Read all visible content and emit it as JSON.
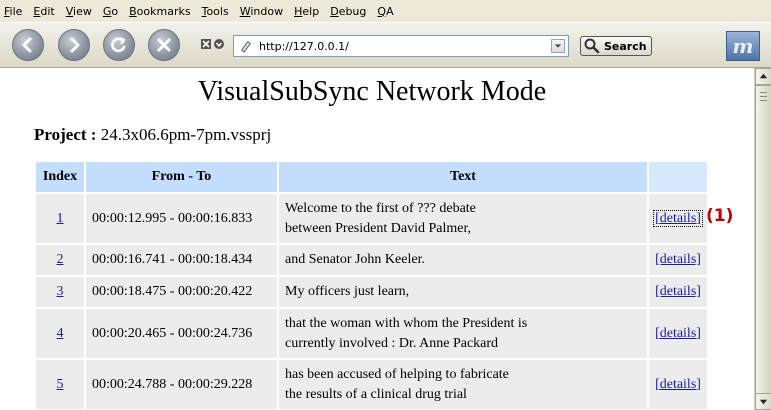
{
  "menu": [
    {
      "pre": "",
      "ul": "F",
      "post": "ile"
    },
    {
      "pre": "",
      "ul": "E",
      "post": "dit"
    },
    {
      "pre": "",
      "ul": "V",
      "post": "iew"
    },
    {
      "pre": "",
      "ul": "G",
      "post": "o"
    },
    {
      "pre": "",
      "ul": "B",
      "post": "ookmarks"
    },
    {
      "pre": "",
      "ul": "T",
      "post": "ools"
    },
    {
      "pre": "",
      "ul": "W",
      "post": "indow"
    },
    {
      "pre": "",
      "ul": "H",
      "post": "elp"
    },
    {
      "pre": "",
      "ul": "D",
      "post": "ebug"
    },
    {
      "pre": "",
      "ul": "Q",
      "post": "A"
    }
  ],
  "navbar": {
    "url": "http://127.0.0.1/",
    "search_label": "Search",
    "throbber_letter": "m"
  },
  "page": {
    "title": "VisualSubSync Network Mode",
    "project_label": "Project :",
    "project_name": "24.3x06.6pm-7pm.vssprj"
  },
  "table": {
    "headers": {
      "index": "Index",
      "time": "From - To",
      "text": "Text",
      "details": ""
    },
    "rows": [
      {
        "index": "1",
        "time": "00:00:12.995 - 00:00:16.833",
        "text1": "Welcome to the first of ??? debate",
        "text2": "between President David Palmer,",
        "details": "[details]"
      },
      {
        "index": "2",
        "time": "00:00:16.741 - 00:00:18.434",
        "text1": "and Senator John Keeler.",
        "text2": "",
        "details": "[details]"
      },
      {
        "index": "3",
        "time": "00:00:18.475 - 00:00:20.422",
        "text1": "My officers just learn,",
        "text2": "",
        "details": "[details]"
      },
      {
        "index": "4",
        "time": "00:00:20.465 - 00:00:24.736",
        "text1": "that the woman with whom the President is",
        "text2": "currently involved : Dr. Anne Packard",
        "details": "[details]"
      },
      {
        "index": "5",
        "time": "00:00:24.788 - 00:00:29.228",
        "text1": "has been accused of helping to fabricate",
        "text2": "the results of a clinical drug trial",
        "details": "[details]"
      }
    ]
  },
  "annotation": "(1)",
  "colors": {
    "header_bg": "#c4deff",
    "cell_bg": "#ececec",
    "link": "#1a1aa6",
    "annotation": "#c00000"
  }
}
